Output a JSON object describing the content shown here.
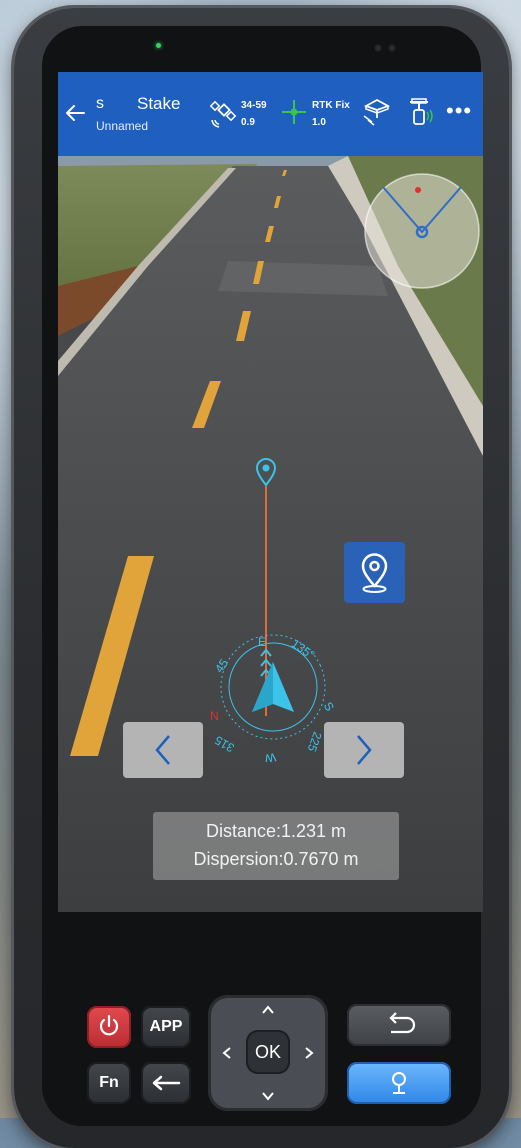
{
  "topbar": {
    "point_name": "s",
    "title": "Stake",
    "project_name": "Unnamed",
    "satellites": "34-59",
    "pdop": "0.9",
    "fix_status": "RTK Fix",
    "fix_value": "1.0"
  },
  "compass": {
    "north_label": "N",
    "east_label": "E",
    "south_label": "S",
    "west_label": "W",
    "deg_45": "45",
    "deg_135": "135°",
    "deg_225": "225",
    "deg_315": "315"
  },
  "info": {
    "distance": "Distance:1.231 m",
    "dispersion": "Dispersion:0.7670 m"
  },
  "keypad": {
    "app_label": "APP",
    "fn_label": "Fn",
    "ok_label": "OK"
  },
  "colors": {
    "topbar": "#1f5fc0",
    "accent_cyan": "#3cc3e8",
    "guide_line": "#e06a3a",
    "power_red": "#d63a40",
    "locate_blue": "#3a8ee8"
  }
}
